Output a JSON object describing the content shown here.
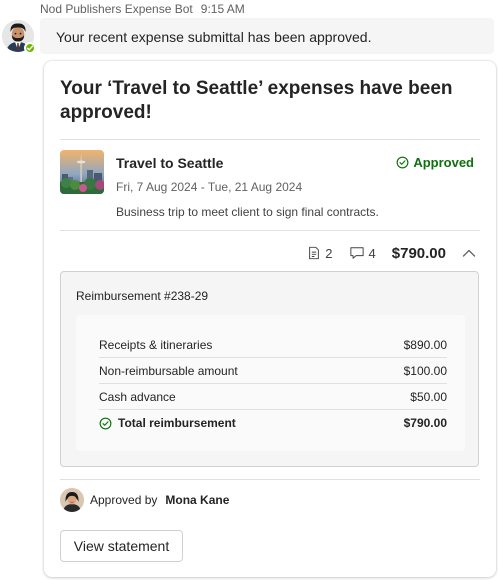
{
  "header": {
    "sender": "Nod Publishers Expense Bot",
    "time": "9:15 AM"
  },
  "message": {
    "text": "Your recent expense submittal has been approved."
  },
  "card": {
    "title": "Your ‘Travel to Seattle’ expenses have been approved!",
    "trip": {
      "name": "Travel to Seattle",
      "dates": "Fri, 7 Aug 2024 - Tue, 21 Aug 2024",
      "description": "Business trip to meet client to sign final contracts.",
      "status": "Approved",
      "status_color": "#0e700e"
    },
    "summary": {
      "receipts_count": "2",
      "comments_count": "4",
      "total": "$790.00"
    },
    "reimbursement": {
      "title": "Reimbursement #238-29",
      "lines": [
        {
          "label": "Receipts & itineraries",
          "amount": "$890.00"
        },
        {
          "label": "Non-reimbursable amount",
          "amount": "$100.00"
        },
        {
          "label": "Cash advance",
          "amount": "$50.00"
        },
        {
          "label": "Total reimbursement",
          "amount": "$790.00"
        }
      ]
    },
    "approval": {
      "prefix": "Approved by",
      "approver": "Mona Kane"
    },
    "button_label": "View statement"
  },
  "icons": {
    "bot_avatar": "bot-avatar-icon",
    "presence": "presence-available-icon",
    "trip_image": "seattle-skyline-image",
    "approved": "checkmark-circle-icon",
    "receipts": "receipt-icon",
    "comments": "comment-icon",
    "collapse": "chevron-up-icon",
    "total_check": "checkmark-circle-icon"
  },
  "colors": {
    "accent_green": "#0e700e",
    "presence_green": "#6bb700"
  }
}
